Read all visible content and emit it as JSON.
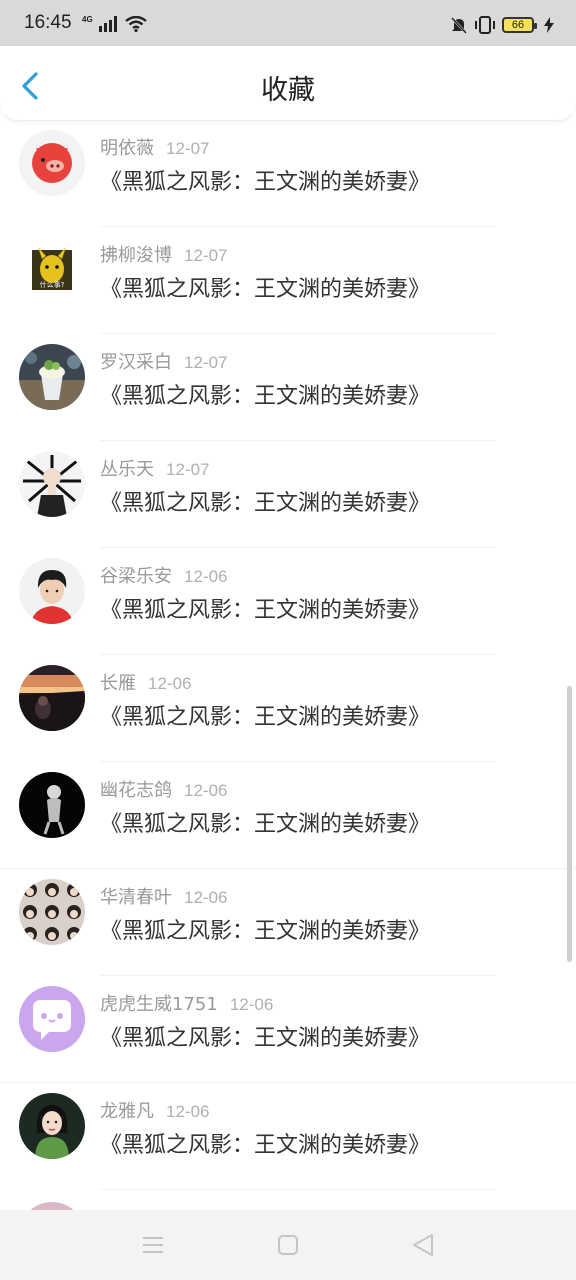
{
  "status_bar": {
    "time": "16:45",
    "network": "4G",
    "battery": "66",
    "icons": [
      "signal-icon",
      "wifi-icon",
      "mute-icon",
      "vibrate-icon",
      "battery-icon",
      "charging-icon"
    ]
  },
  "header": {
    "title": "收藏",
    "back_icon": "back-arrow-icon"
  },
  "favorites": [
    {
      "name": "明依薇",
      "date": "12-07",
      "title": "《黑狐之风影：王文渊的美娇妻》",
      "avatar": "pig-sticker"
    },
    {
      "name": "拂柳浚博",
      "date": "12-07",
      "title": "《黑狐之风影：王文渊的美娇妻》",
      "avatar": "pikachu-meme",
      "avatar_caption": "什么事?"
    },
    {
      "name": "罗汉采白",
      "date": "12-07",
      "title": "《黑狐之风影：王文渊的美娇妻》",
      "avatar": "drink-photo"
    },
    {
      "name": "丛乐天",
      "date": "12-07",
      "title": "《黑狐之风影：王文渊的美娇妻》",
      "avatar": "girl-drawing"
    },
    {
      "name": "谷梁乐安",
      "date": "12-06",
      "title": "《黑狐之风影：王文渊的美娇妻》",
      "avatar": "boy-red-shirt"
    },
    {
      "name": "长雁",
      "date": "12-06",
      "title": "《黑狐之风影：王文渊的美娇妻》",
      "avatar": "car-sunset"
    },
    {
      "name": "幽花志鸽",
      "date": "12-06",
      "title": "《黑狐之风影：王文渊的美娇妻》",
      "avatar": "bw-figure"
    },
    {
      "name": "华清春叶",
      "date": "12-06",
      "title": "《黑狐之风影：王文渊的美娇妻》",
      "avatar": "photo-grid"
    },
    {
      "name": "虎虎生威1751",
      "date": "12-06",
      "title": "《黑狐之风影：王文渊的美娇妻》",
      "avatar": "chat-bubble"
    },
    {
      "name": "龙雅凡",
      "date": "12-06",
      "title": "《黑狐之风影：王文渊的美娇妻》",
      "avatar": "girl-portrait"
    }
  ],
  "nav_bar": {
    "icons": [
      "menu-icon",
      "home-square-icon",
      "back-triangle-icon"
    ]
  },
  "colors": {
    "accent": "#2a9fd8",
    "status_bar_bg": "#d9d9d9",
    "meta_text": "#9a9a9a",
    "title_text": "#333333",
    "battery_fill": "#f5e15a"
  }
}
